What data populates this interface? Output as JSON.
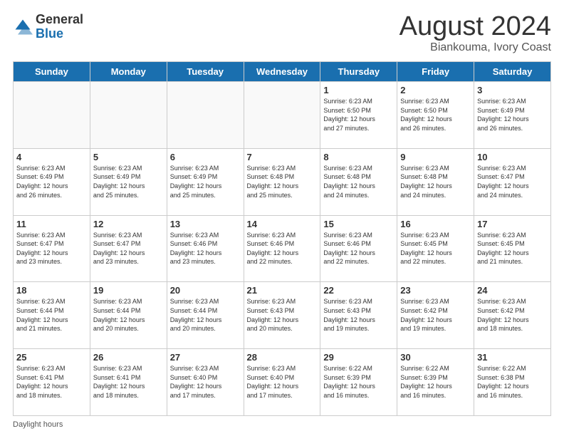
{
  "header": {
    "logo_general": "General",
    "logo_blue": "Blue",
    "month_title": "August 2024",
    "location": "Biankouma, Ivory Coast"
  },
  "weekdays": [
    "Sunday",
    "Monday",
    "Tuesday",
    "Wednesday",
    "Thursday",
    "Friday",
    "Saturday"
  ],
  "weeks": [
    [
      {
        "day": "",
        "info": ""
      },
      {
        "day": "",
        "info": ""
      },
      {
        "day": "",
        "info": ""
      },
      {
        "day": "",
        "info": ""
      },
      {
        "day": "1",
        "info": "Sunrise: 6:23 AM\nSunset: 6:50 PM\nDaylight: 12 hours\nand 27 minutes."
      },
      {
        "day": "2",
        "info": "Sunrise: 6:23 AM\nSunset: 6:50 PM\nDaylight: 12 hours\nand 26 minutes."
      },
      {
        "day": "3",
        "info": "Sunrise: 6:23 AM\nSunset: 6:49 PM\nDaylight: 12 hours\nand 26 minutes."
      }
    ],
    [
      {
        "day": "4",
        "info": "Sunrise: 6:23 AM\nSunset: 6:49 PM\nDaylight: 12 hours\nand 26 minutes."
      },
      {
        "day": "5",
        "info": "Sunrise: 6:23 AM\nSunset: 6:49 PM\nDaylight: 12 hours\nand 25 minutes."
      },
      {
        "day": "6",
        "info": "Sunrise: 6:23 AM\nSunset: 6:49 PM\nDaylight: 12 hours\nand 25 minutes."
      },
      {
        "day": "7",
        "info": "Sunrise: 6:23 AM\nSunset: 6:48 PM\nDaylight: 12 hours\nand 25 minutes."
      },
      {
        "day": "8",
        "info": "Sunrise: 6:23 AM\nSunset: 6:48 PM\nDaylight: 12 hours\nand 24 minutes."
      },
      {
        "day": "9",
        "info": "Sunrise: 6:23 AM\nSunset: 6:48 PM\nDaylight: 12 hours\nand 24 minutes."
      },
      {
        "day": "10",
        "info": "Sunrise: 6:23 AM\nSunset: 6:47 PM\nDaylight: 12 hours\nand 24 minutes."
      }
    ],
    [
      {
        "day": "11",
        "info": "Sunrise: 6:23 AM\nSunset: 6:47 PM\nDaylight: 12 hours\nand 23 minutes."
      },
      {
        "day": "12",
        "info": "Sunrise: 6:23 AM\nSunset: 6:47 PM\nDaylight: 12 hours\nand 23 minutes."
      },
      {
        "day": "13",
        "info": "Sunrise: 6:23 AM\nSunset: 6:46 PM\nDaylight: 12 hours\nand 23 minutes."
      },
      {
        "day": "14",
        "info": "Sunrise: 6:23 AM\nSunset: 6:46 PM\nDaylight: 12 hours\nand 22 minutes."
      },
      {
        "day": "15",
        "info": "Sunrise: 6:23 AM\nSunset: 6:46 PM\nDaylight: 12 hours\nand 22 minutes."
      },
      {
        "day": "16",
        "info": "Sunrise: 6:23 AM\nSunset: 6:45 PM\nDaylight: 12 hours\nand 22 minutes."
      },
      {
        "day": "17",
        "info": "Sunrise: 6:23 AM\nSunset: 6:45 PM\nDaylight: 12 hours\nand 21 minutes."
      }
    ],
    [
      {
        "day": "18",
        "info": "Sunrise: 6:23 AM\nSunset: 6:44 PM\nDaylight: 12 hours\nand 21 minutes."
      },
      {
        "day": "19",
        "info": "Sunrise: 6:23 AM\nSunset: 6:44 PM\nDaylight: 12 hours\nand 20 minutes."
      },
      {
        "day": "20",
        "info": "Sunrise: 6:23 AM\nSunset: 6:44 PM\nDaylight: 12 hours\nand 20 minutes."
      },
      {
        "day": "21",
        "info": "Sunrise: 6:23 AM\nSunset: 6:43 PM\nDaylight: 12 hours\nand 20 minutes."
      },
      {
        "day": "22",
        "info": "Sunrise: 6:23 AM\nSunset: 6:43 PM\nDaylight: 12 hours\nand 19 minutes."
      },
      {
        "day": "23",
        "info": "Sunrise: 6:23 AM\nSunset: 6:42 PM\nDaylight: 12 hours\nand 19 minutes."
      },
      {
        "day": "24",
        "info": "Sunrise: 6:23 AM\nSunset: 6:42 PM\nDaylight: 12 hours\nand 18 minutes."
      }
    ],
    [
      {
        "day": "25",
        "info": "Sunrise: 6:23 AM\nSunset: 6:41 PM\nDaylight: 12 hours\nand 18 minutes."
      },
      {
        "day": "26",
        "info": "Sunrise: 6:23 AM\nSunset: 6:41 PM\nDaylight: 12 hours\nand 18 minutes."
      },
      {
        "day": "27",
        "info": "Sunrise: 6:23 AM\nSunset: 6:40 PM\nDaylight: 12 hours\nand 17 minutes."
      },
      {
        "day": "28",
        "info": "Sunrise: 6:23 AM\nSunset: 6:40 PM\nDaylight: 12 hours\nand 17 minutes."
      },
      {
        "day": "29",
        "info": "Sunrise: 6:22 AM\nSunset: 6:39 PM\nDaylight: 12 hours\nand 16 minutes."
      },
      {
        "day": "30",
        "info": "Sunrise: 6:22 AM\nSunset: 6:39 PM\nDaylight: 12 hours\nand 16 minutes."
      },
      {
        "day": "31",
        "info": "Sunrise: 6:22 AM\nSunset: 6:38 PM\nDaylight: 12 hours\nand 16 minutes."
      }
    ]
  ],
  "footer": {
    "daylight_label": "Daylight hours"
  }
}
